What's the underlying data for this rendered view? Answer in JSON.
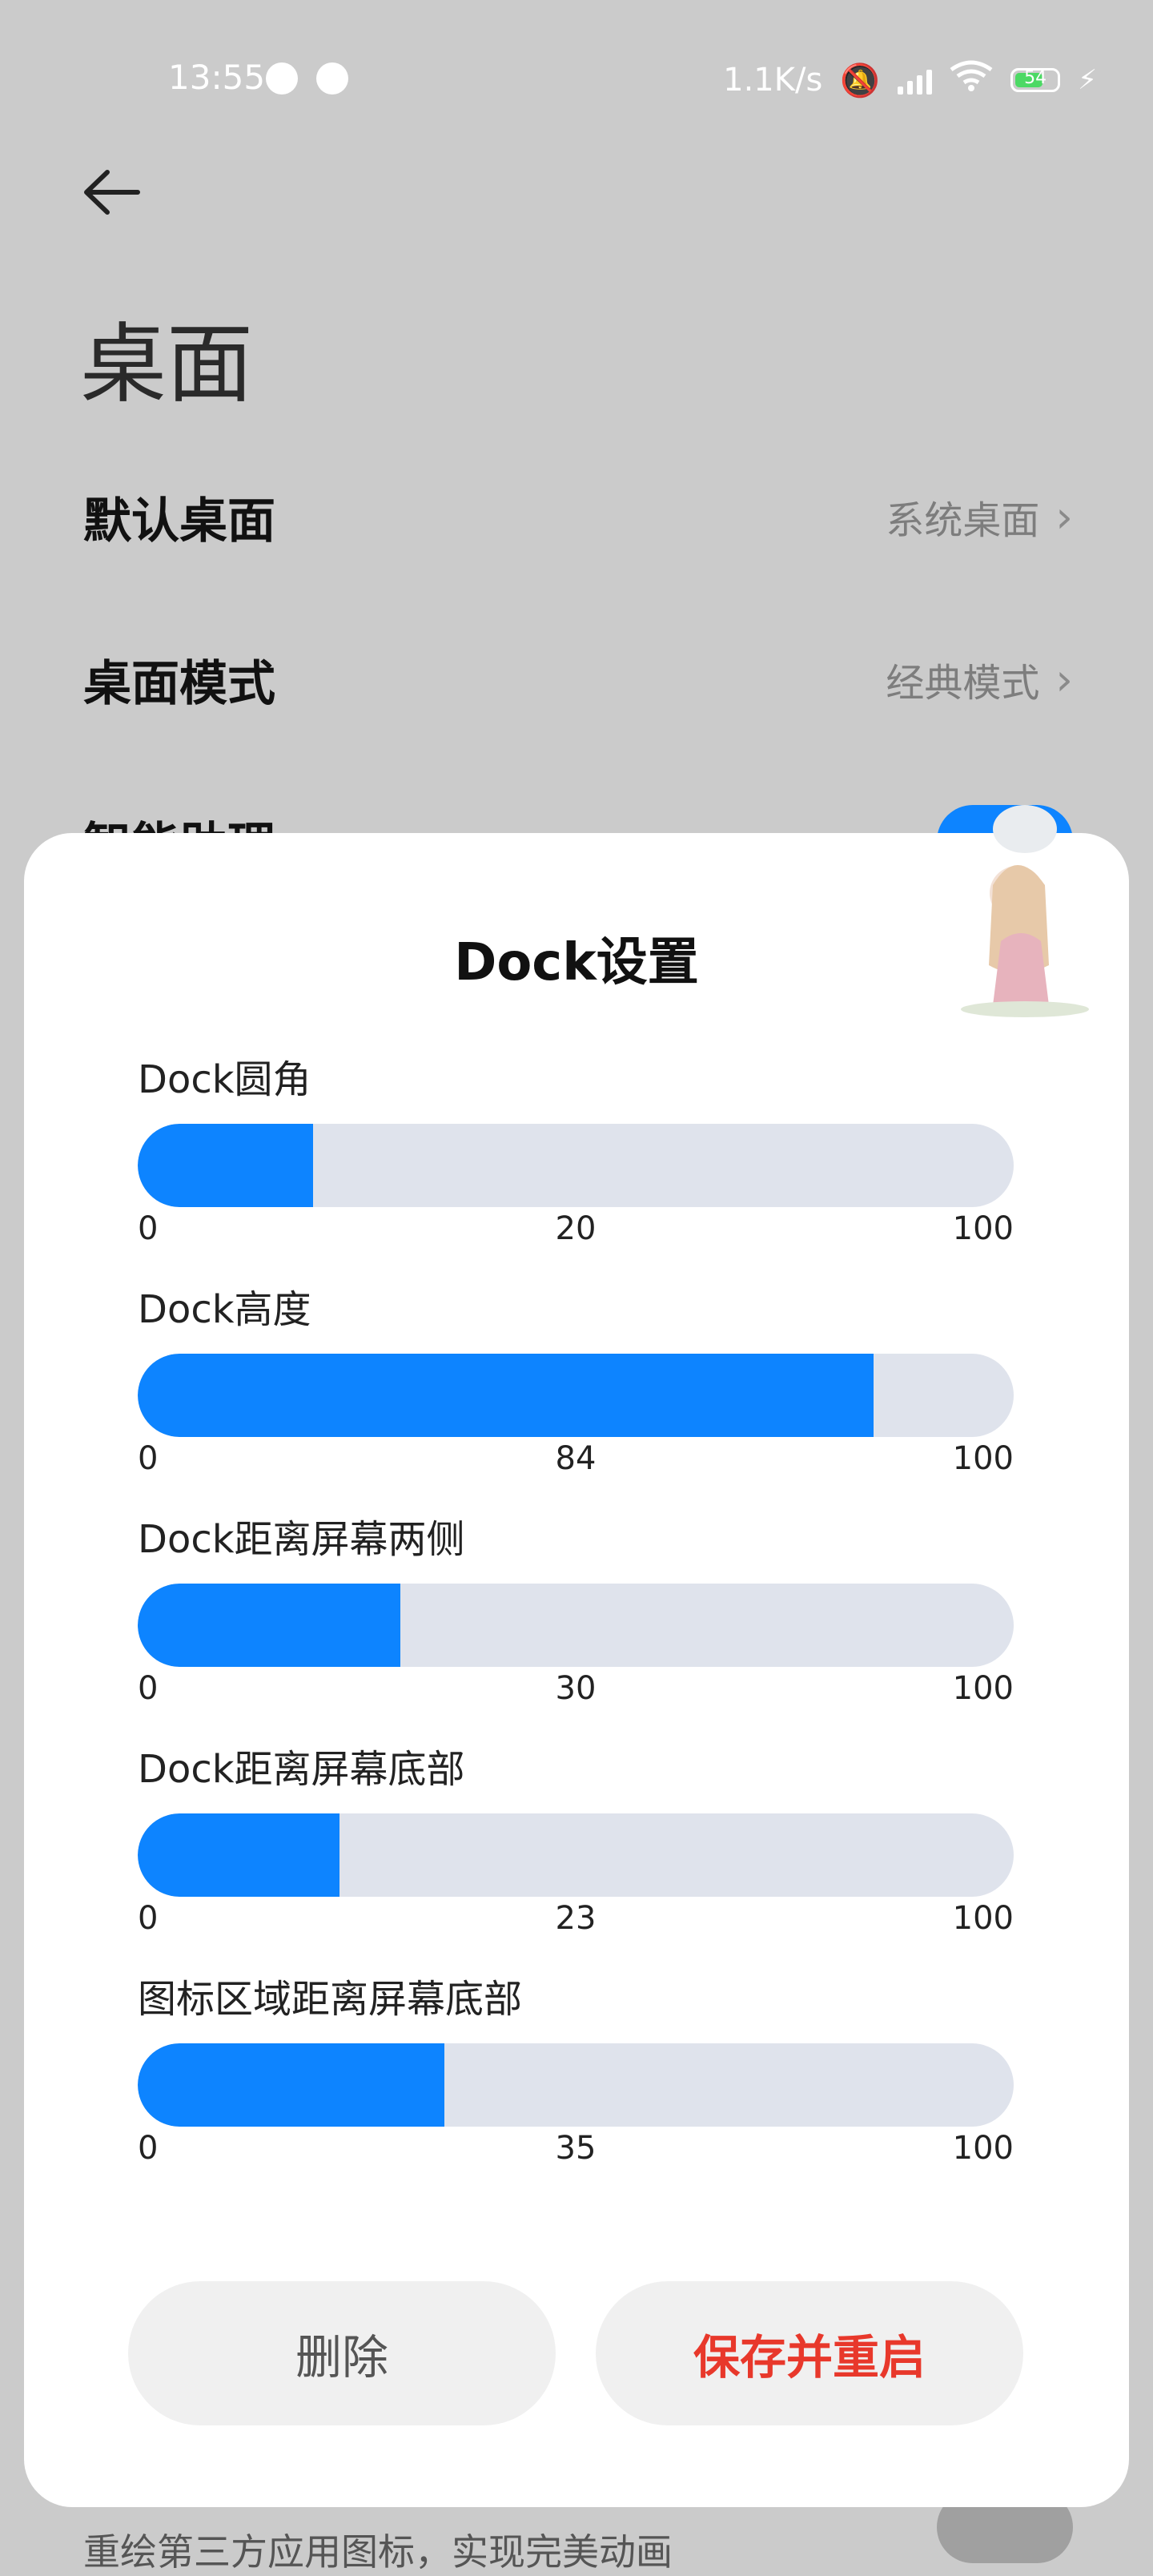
{
  "status_bar": {
    "time": "13:55",
    "net_speed": "1.1K/s",
    "battery": "54"
  },
  "page": {
    "title": "桌面",
    "rows": [
      {
        "label": "默认桌面",
        "value": "系统桌面"
      },
      {
        "label": "桌面模式",
        "value": "经典模式"
      },
      {
        "label": "智能助理"
      }
    ],
    "bottom_desc": "重绘第三方应用图标，实现完美动画"
  },
  "modal": {
    "title": "Dock设置",
    "sliders": [
      {
        "label": "Dock圆角",
        "min": "0",
        "value": "20",
        "max": "100",
        "fraction": 0.2
      },
      {
        "label": "Dock高度",
        "min": "0",
        "value": "84",
        "max": "100",
        "fraction": 0.84
      },
      {
        "label": "Dock距离屏幕两侧",
        "min": "0",
        "value": "30",
        "max": "100",
        "fraction": 0.3
      },
      {
        "label": "Dock距离屏幕底部",
        "min": "0",
        "value": "23",
        "max": "100",
        "fraction": 0.23
      },
      {
        "label": "图标区域距离屏幕底部",
        "min": "0",
        "value": "35",
        "max": "100",
        "fraction": 0.35
      }
    ],
    "buttons": {
      "delete": "删除",
      "save": "保存并重启"
    }
  },
  "colors": {
    "accent": "#0d84ff",
    "track": "#dfe3ec",
    "danger": "#e8382b"
  }
}
